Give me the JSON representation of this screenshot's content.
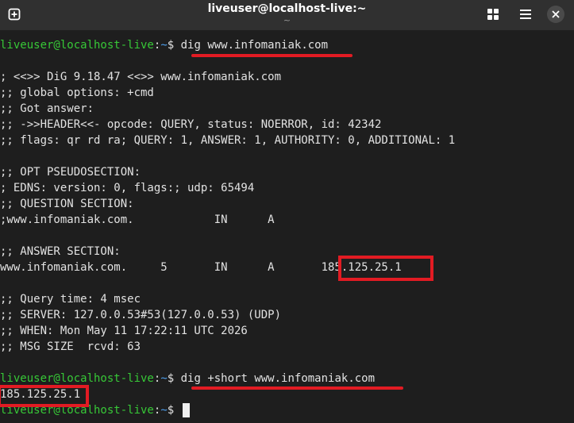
{
  "window": {
    "title": "liveuser@localhost-live:~",
    "subtitle": "~"
  },
  "prompt": {
    "host": "liveuser@localhost-live",
    "colon": ":",
    "path": "~",
    "symbol": "$ "
  },
  "terminal": {
    "cmd1": "dig www.infomaniak.com",
    "out": [
      "; <<>> DiG 9.18.47 <<>> www.infomaniak.com",
      ";; global options: +cmd",
      ";; Got answer:",
      ";; ->>HEADER<<- opcode: QUERY, status: NOERROR, id: 42342",
      ";; flags: qr rd ra; QUERY: 1, ANSWER: 1, AUTHORITY: 0, ADDITIONAL: 1",
      "",
      ";; OPT PSEUDOSECTION:",
      "; EDNS: version: 0, flags:; udp: 65494",
      ";; QUESTION SECTION:",
      ";www.infomaniak.com.            IN      A",
      "",
      ";; ANSWER SECTION:",
      "www.infomaniak.com.     5       IN      A       185.125.25.1",
      "",
      ";; Query time: 4 msec",
      ";; SERVER: 127.0.0.53#53(127.0.0.53) (UDP)",
      ";; WHEN: Mon May 11 17:22:11 UTC 2026",
      ";; MSG SIZE  rcvd: 63",
      ""
    ],
    "cmd2": "dig +short www.infomaniak.com",
    "short_result": "185.125.25.1"
  },
  "colors": {
    "prompt_host": "#37c837",
    "prompt_path": "#4ea0ee",
    "annotation": "#e21b23",
    "background": "#1e1e1e",
    "titlebar": "#303030"
  },
  "icons": [
    "new-tab-icon",
    "grid-icon",
    "hamburger-menu-icon",
    "close-icon"
  ]
}
